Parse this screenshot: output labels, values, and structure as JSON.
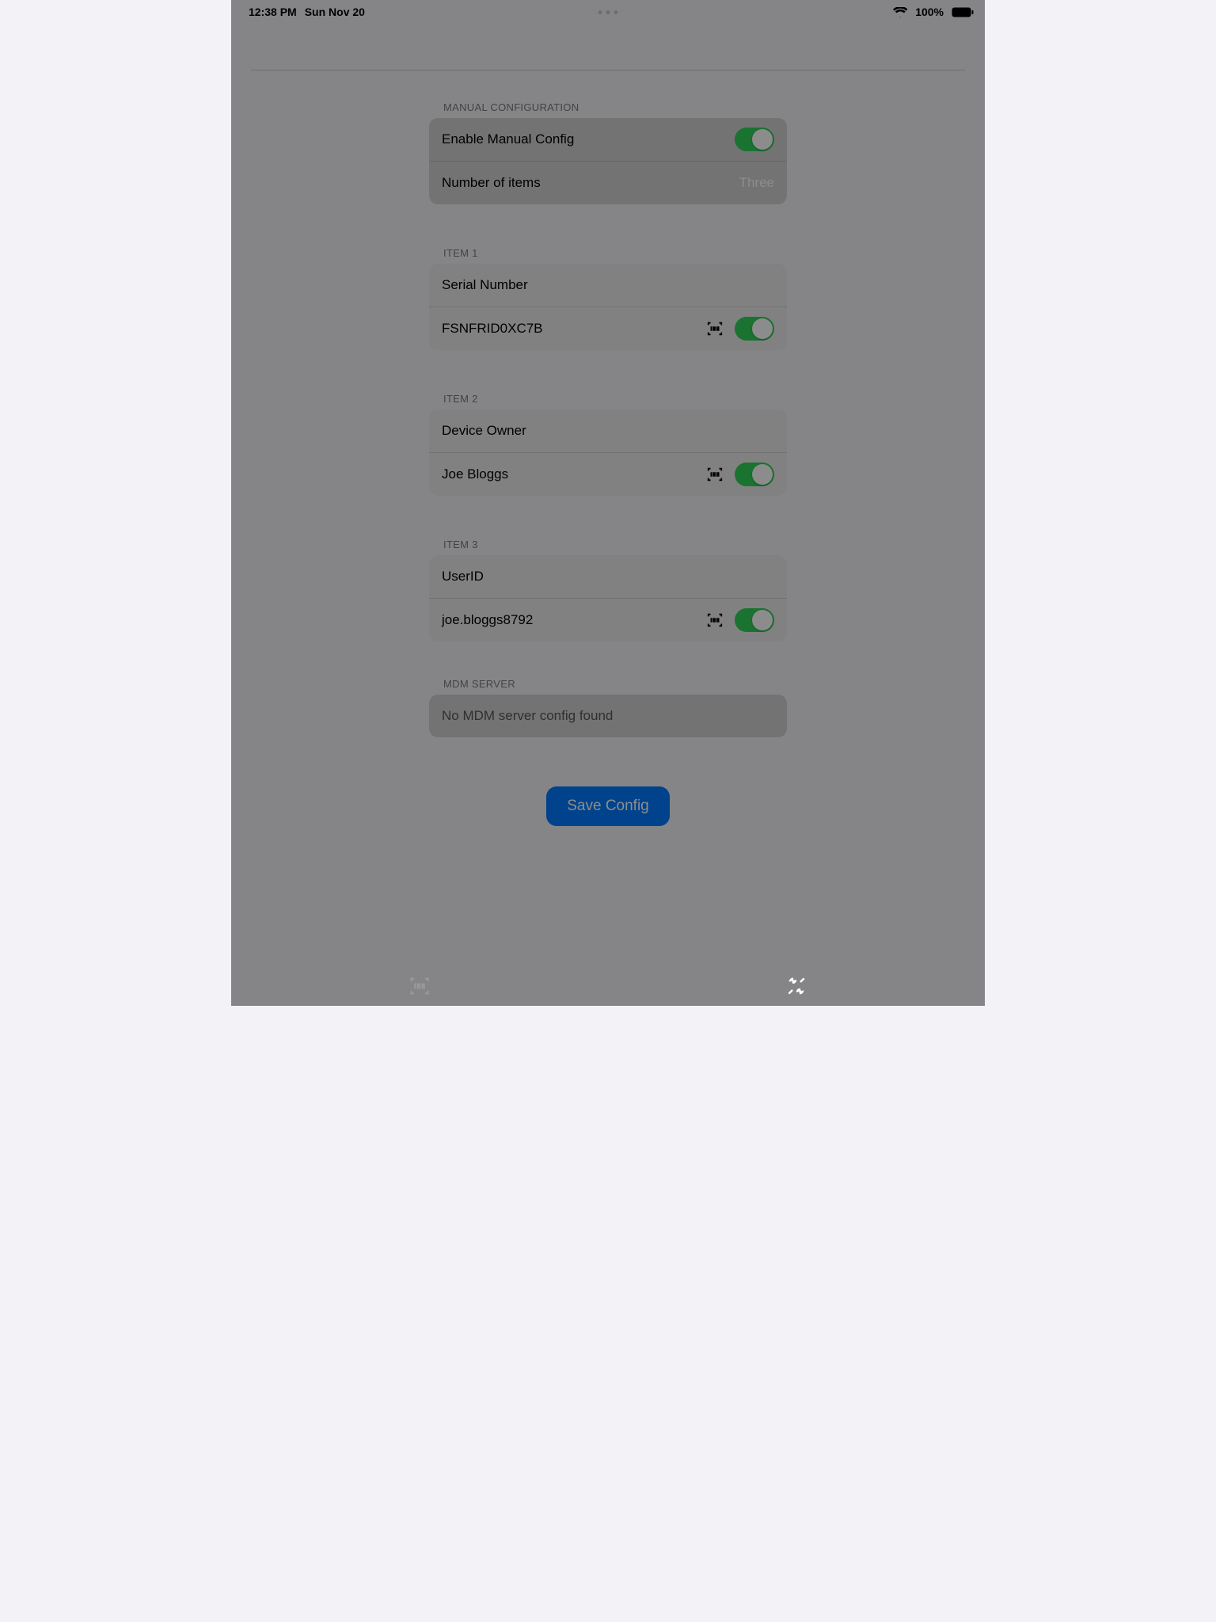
{
  "statusbar": {
    "time": "12:38 PM",
    "date": "Sun Nov 20",
    "battery": "100%"
  },
  "sections": {
    "manual": {
      "header": "MANUAL CONFIGURATION",
      "enable_label": "Enable Manual Config",
      "items_label": "Number of items",
      "items_value": "Three"
    },
    "item1": {
      "header": "ITEM 1",
      "title": "Serial Number",
      "value": "FSNFRID0XC7B"
    },
    "item2": {
      "header": "ITEM 2",
      "title": "Device Owner",
      "value": "Joe Bloggs"
    },
    "item3": {
      "header": "ITEM 3",
      "title": "UserID",
      "value": "joe.bloggs8792"
    },
    "mdm": {
      "header": "MDM SERVER",
      "status": "No MDM server config found"
    }
  },
  "save_button": "Save Config"
}
